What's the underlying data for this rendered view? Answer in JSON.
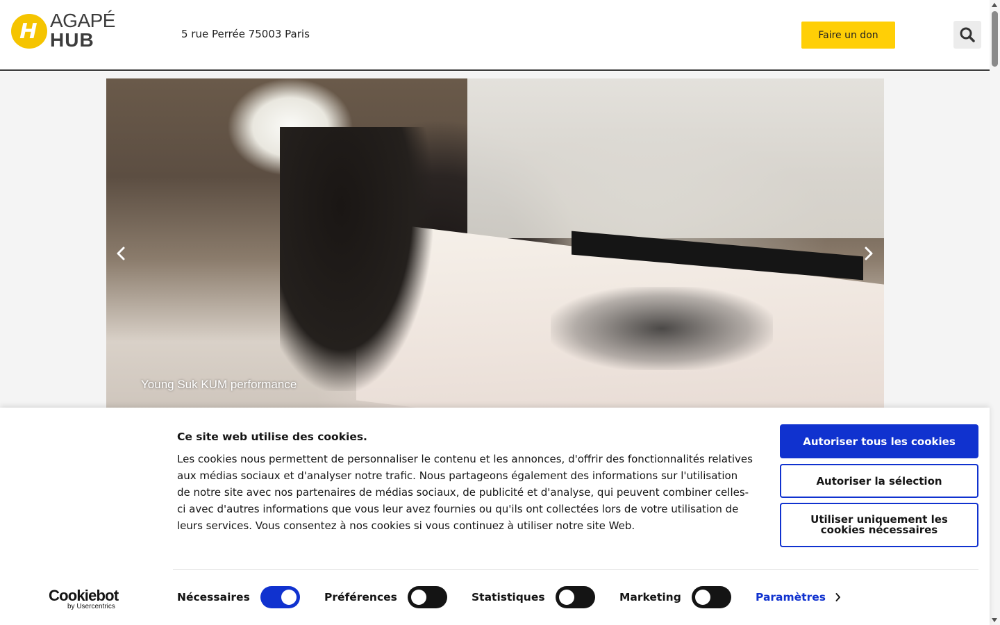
{
  "header": {
    "logo_top": "AGAPÉ",
    "logo_bottom": "HUB",
    "address": "5 rue Perrée 75003 Paris",
    "donate_label": "Faire un don",
    "search_icon": "search-icon"
  },
  "slider": {
    "caption": "Young Suk KUM performance",
    "prev_icon": "chevron-left-icon",
    "next_icon": "chevron-right-icon"
  },
  "cookie_banner": {
    "title": "Ce site web utilise des cookies.",
    "text": "Les cookies nous permettent de personnaliser le contenu et les annonces, d'offrir des fonctionnalités relatives aux médias sociaux et d'analyser notre trafic. Nous partageons également des informations sur l'utilisation de notre site avec nos partenaires de médias sociaux, de publicité et d'analyse, qui peuvent combiner celles-ci avec d'autres informations que vous leur avez fournies ou qu'ils ont collectées lors de votre utilisation de leurs services. Vous consentez à nos cookies si vous continuez à utiliser notre site Web.",
    "buttons": {
      "allow_all": "Autoriser tous les cookies",
      "allow_selection": "Autoriser la sélection",
      "necessary_only": "Utiliser uniquement les cookies nécessaires"
    },
    "brand": {
      "name": "Cookiebot",
      "sub": "by Usercentrics"
    },
    "toggles": [
      {
        "label": "Nécessaires",
        "state": "on"
      },
      {
        "label": "Préférences",
        "state": "off"
      },
      {
        "label": "Statistiques",
        "state": "off"
      },
      {
        "label": "Marketing",
        "state": "off"
      }
    ],
    "settings_link": "Paramètres"
  },
  "colors": {
    "brand_yellow": "#ffcf06",
    "cookie_blue": "#1032cf",
    "text_dark": "#141414"
  }
}
